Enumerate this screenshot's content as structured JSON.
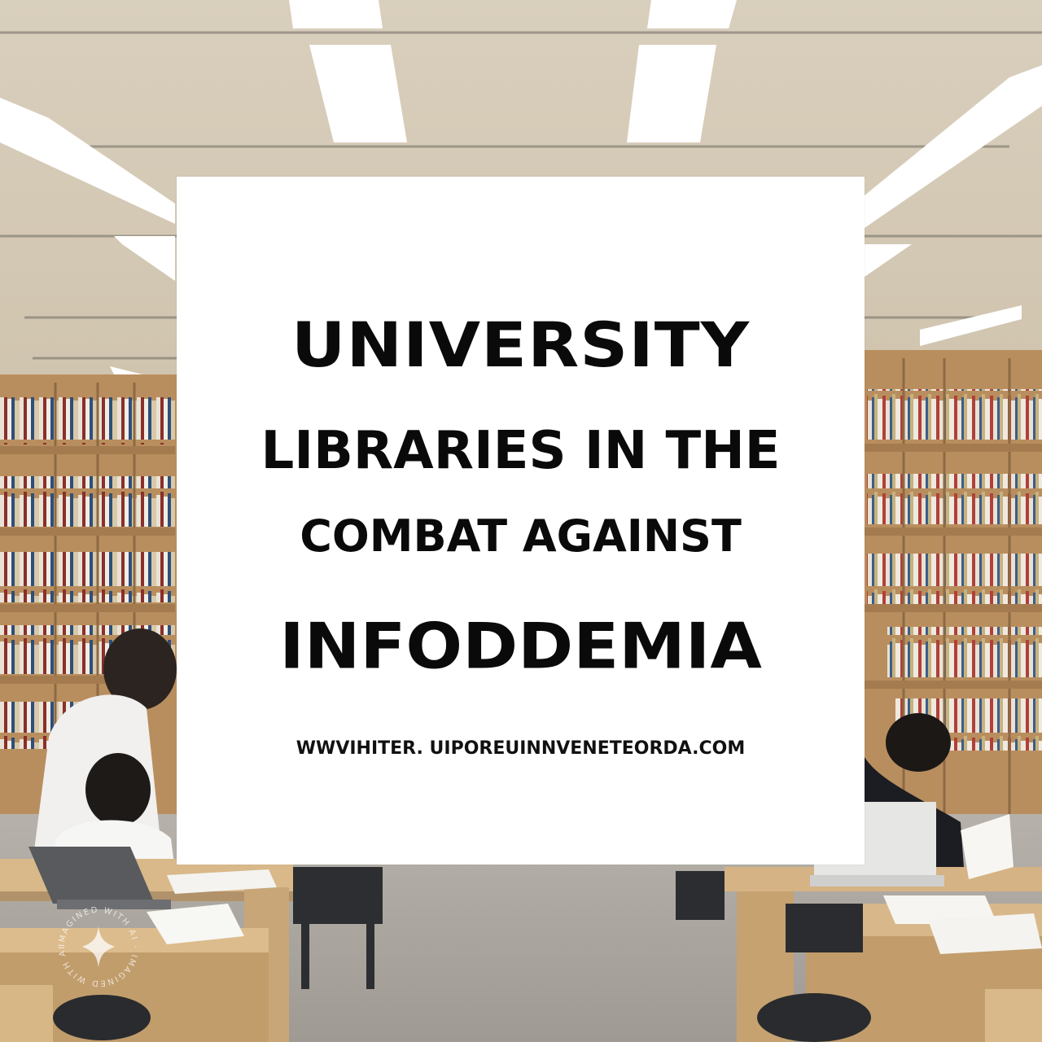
{
  "poster": {
    "line1": "UNIVERSITY",
    "line2": "LIBRARIES IN THE",
    "line3": "COMBAT AGAINST",
    "line4": "INFODDEMIA",
    "url": "WWVIHITER. UIPOREUINNVENETEORDA.COM"
  },
  "watermark": {
    "text": "IMAGINED WITH AI · IMAGINED WITH AI",
    "icon": "sparkle-icon"
  },
  "colors": {
    "card": "#ffffff",
    "text": "#0a0a0a",
    "ceiling": "#d8cdb8",
    "shelf_wood": "#b98e5e",
    "desk_wood": "#d9b98a",
    "floor": "#a7a29b"
  }
}
